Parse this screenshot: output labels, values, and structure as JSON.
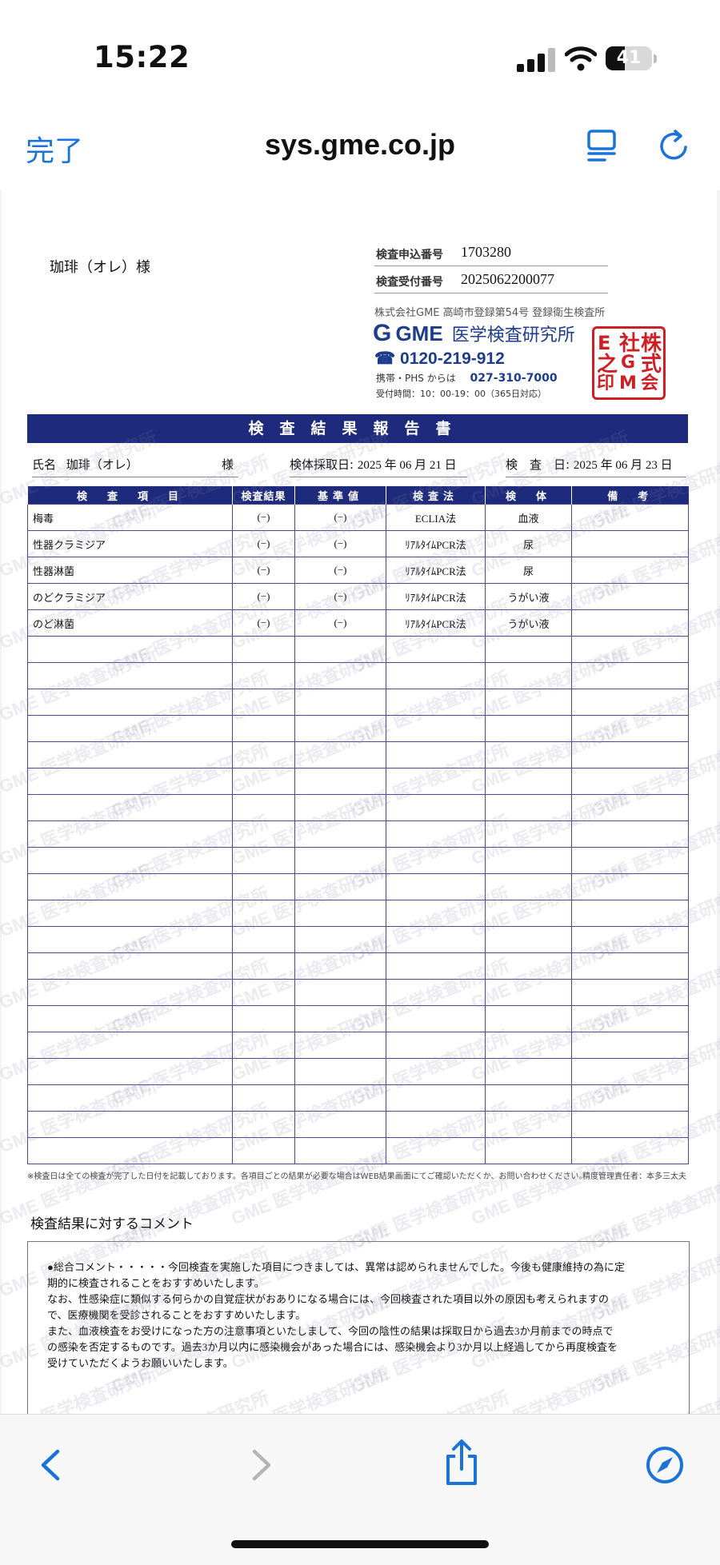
{
  "status_bar": {
    "time": "15:22",
    "battery": "41",
    "battery_level": 0.41
  },
  "browser": {
    "done_label": "完了",
    "url": "sys.gme.co.jp"
  },
  "report": {
    "patient_name": "珈琲（オレ）様",
    "application_no_label": "検査申込番号",
    "application_no": "1703280",
    "reception_no_label": "検査受付番号",
    "reception_no": "2025062200077",
    "lab_registration": "株式会社GME  高崎市登録第54号  登録衛生検査所",
    "lab_logo_brand": "GME",
    "lab_logo_name": "医学検査研究所",
    "lab_phone": "0120-219-912",
    "mobile_label": "携帯・PHS からは",
    "mobile_phone": "027-310-7000",
    "hours": "受付時間：10：00-19：00（365日対応）",
    "seal_chars": [
      "株",
      "式",
      "会",
      "社",
      "G",
      "M",
      "E",
      "之",
      "印"
    ],
    "title": "検査結果報告書",
    "name_label": "氏名",
    "name_value": "珈琲（オレ）",
    "honorific": "様",
    "collection_date_label": "検体採取日:",
    "collection_date": "2025 年 06 月 21 日",
    "test_date_label": "検　査　日:",
    "test_date": "2025 年 06 月 23 日",
    "columns": [
      "検　査　項　目",
      "検査結果",
      "基準値",
      "検査法",
      "検　体",
      "備　考"
    ],
    "rows": [
      {
        "item": "梅毒",
        "result": "(−)",
        "reference": "(−)",
        "method": "ECLIA法",
        "specimen": "血液",
        "note": ""
      },
      {
        "item": "性器クラミジア",
        "result": "(−)",
        "reference": "(−)",
        "method": "ﾘｱﾙﾀｲﾑPCR法",
        "specimen": "尿",
        "note": ""
      },
      {
        "item": "性器淋菌",
        "result": "(−)",
        "reference": "(−)",
        "method": "ﾘｱﾙﾀｲﾑPCR法",
        "specimen": "尿",
        "note": ""
      },
      {
        "item": "のどクラミジア",
        "result": "(−)",
        "reference": "(−)",
        "method": "ﾘｱﾙﾀｲﾑPCR法",
        "specimen": "うがい液",
        "note": ""
      },
      {
        "item": "のど淋菌",
        "result": "(−)",
        "reference": "(−)",
        "method": "ﾘｱﾙﾀｲﾑPCR法",
        "specimen": "うがい液",
        "note": ""
      }
    ],
    "footnote": "※検査日は全ての検査が完了した日付を記載しております。各項目ごとの結果が必要な場合はWEB結果画面にてご確認いただくか、お問い合わせください。",
    "quality_manager": "精度管理責任者：本多三太夫",
    "watermark": "GME 医学検査研究所",
    "comment_title": "検査結果に対するコメント",
    "comment_lines": [
      "●総合コメント・・・・・今回検査を実施した項目につきましては、異常は認められませんでした。今後も健康維持の為に定",
      "期的に検査されることをおすすめいたします。",
      "なお、性感染症に類似する何らかの自覚症状がおありになる場合には、今回検査された項目以外の原因も考えられますの",
      "で、医療機関を受診されることをおすすめいたします。",
      "また、血液検査をお受けになった方の注意事項といたしまして、今回の陰性の結果は採取日から過去3か月前までの時点で",
      "の感染を否定するものです。過去3か月以内に感染機会があった場合には、感染機会より3か月以上経過してから再度検査を",
      "受けていただくようお願いいたします。"
    ]
  },
  "toolbar": {
    "back_icon": "chevron-left-icon",
    "forward_icon": "chevron-right-icon",
    "share_icon": "share-icon",
    "safari_icon": "compass-icon"
  },
  "colors": {
    "accent": "#1a73d9",
    "header_navy": "#1e2a7c",
    "grid_line": "#4b4b8c",
    "seal_red": "#cf1f24"
  }
}
